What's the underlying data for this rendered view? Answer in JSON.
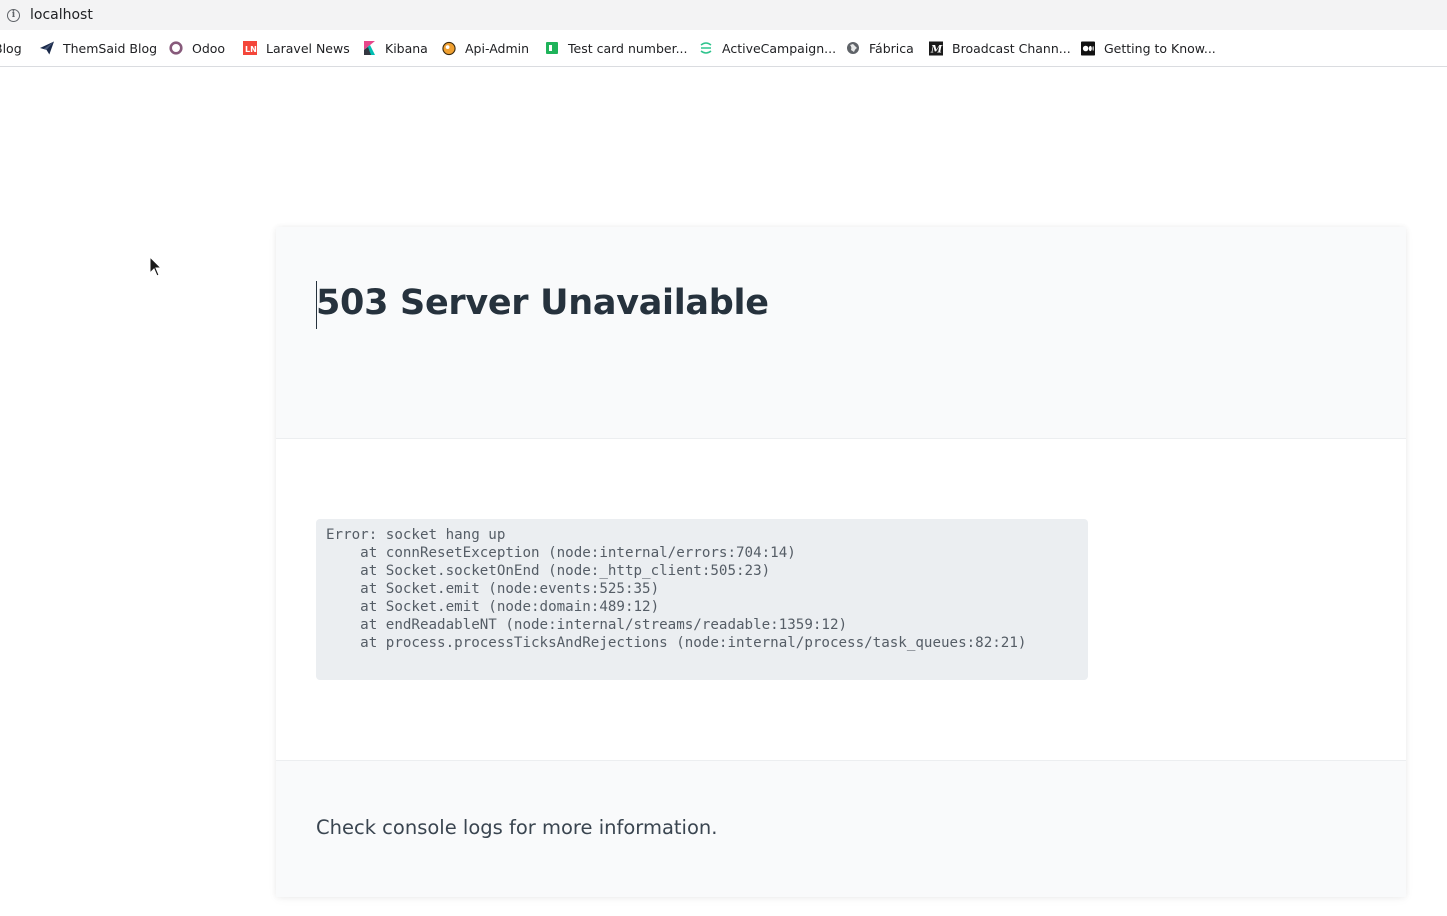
{
  "browser": {
    "url": "localhost",
    "bookmarks": [
      {
        "label": "Blog",
        "icon": "blog-icon"
      },
      {
        "label": "ThemSaid Blog",
        "icon": "paper-plane-icon"
      },
      {
        "label": "Odoo",
        "icon": "odoo-ring-icon"
      },
      {
        "label": "Laravel News",
        "icon": "laravel-news-icon"
      },
      {
        "label": "Kibana",
        "icon": "kibana-icon"
      },
      {
        "label": "Api-Admin",
        "icon": "api-admin-icon"
      },
      {
        "label": "Test card number...",
        "icon": "green-square-icon"
      },
      {
        "label": "ActiveCampaign...",
        "icon": "activecampaign-icon"
      },
      {
        "label": "Fábrica",
        "icon": "globe-icon"
      },
      {
        "label": "Broadcast Chann...",
        "icon": "m-logo-icon"
      },
      {
        "label": "Getting to Know...",
        "icon": "medium-logo-icon"
      }
    ]
  },
  "page": {
    "title": "503 Server Unavailable",
    "stack_trace": "Error: socket hang up\n    at connResetException (node:internal/errors:704:14)\n    at Socket.socketOnEnd (node:_http_client:505:23)\n    at Socket.emit (node:events:525:35)\n    at Socket.emit (node:domain:489:12)\n    at endReadableNT (node:internal/streams/readable:1359:12)\n    at process.processTicksAndRejections (node:internal/process/task_queues:82:21)",
    "footer_message": "Check console logs for more information."
  }
}
